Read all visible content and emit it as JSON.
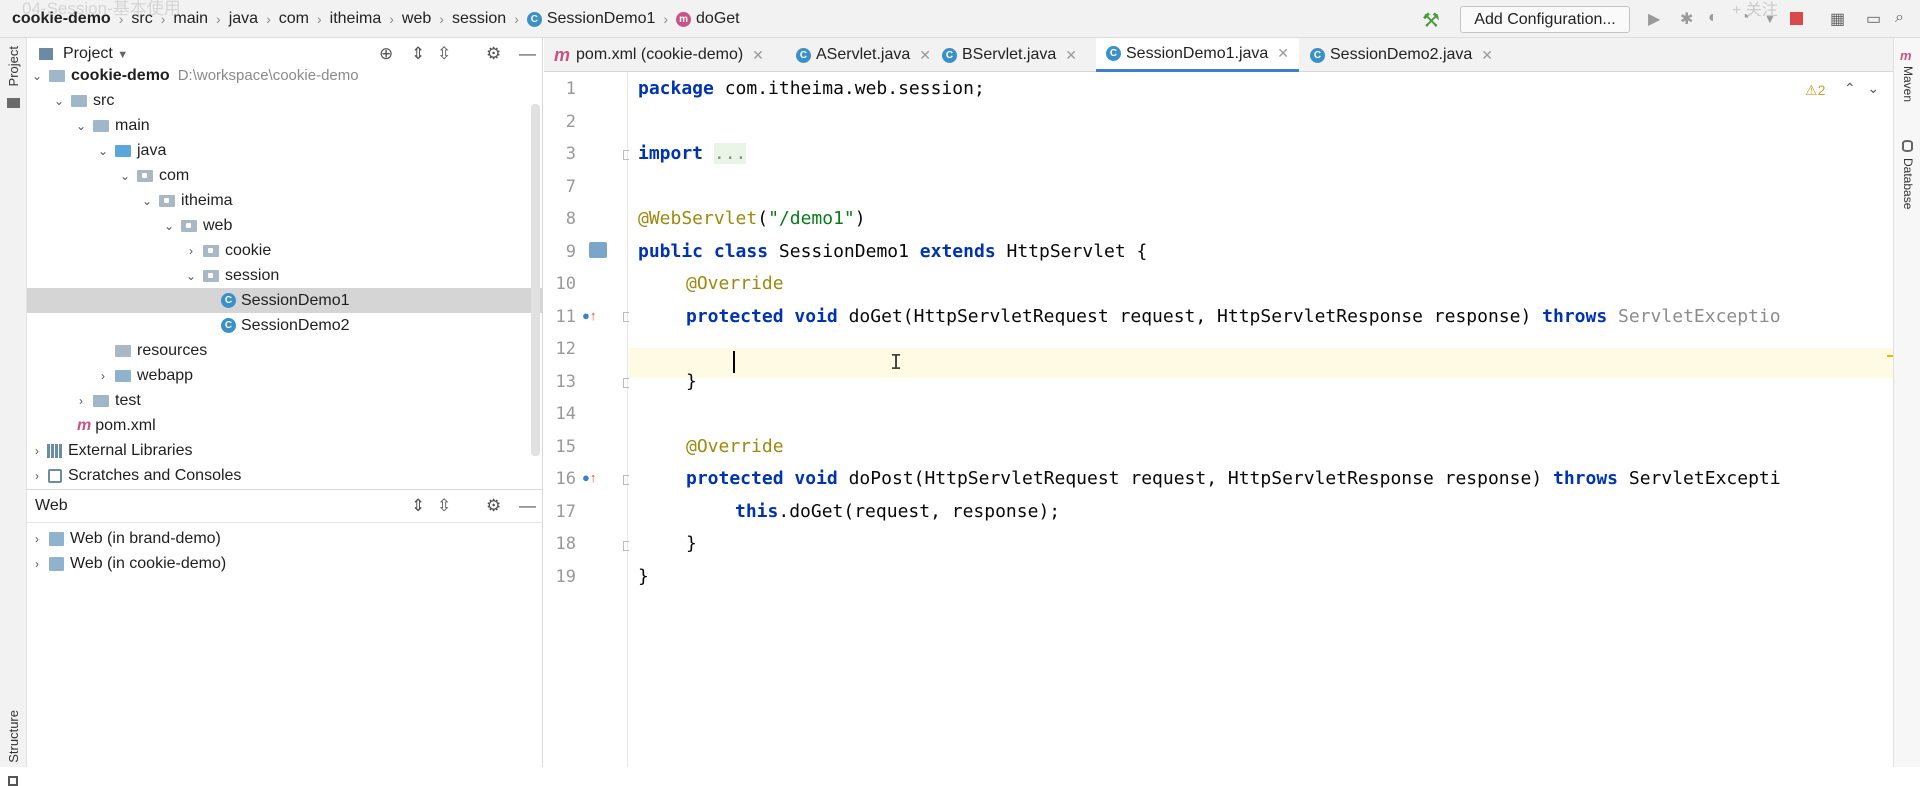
{
  "window": {
    "watermark": "04-Session-基本使用",
    "overlay": "+ 关注"
  },
  "breadcrumb": [
    "cookie-demo",
    "src",
    "main",
    "java",
    "com",
    "itheima",
    "web",
    "session",
    "SessionDemo1",
    "doGet"
  ],
  "toolbar": {
    "run_config": "Add Configuration..."
  },
  "side_left": {
    "project_tab": "Project",
    "structure_tab": "Structure"
  },
  "side_right": {
    "maven_tab": "Maven",
    "database_tab": "Database"
  },
  "project_panel": {
    "title": "Project",
    "tree": [
      {
        "label": "cookie-demo",
        "path": "D:\\workspace\\cookie-demo"
      },
      {
        "label": "src"
      },
      {
        "label": "main"
      },
      {
        "label": "java"
      },
      {
        "label": "com"
      },
      {
        "label": "itheima"
      },
      {
        "label": "web"
      },
      {
        "label": "cookie"
      },
      {
        "label": "session"
      },
      {
        "label": "SessionDemo1"
      },
      {
        "label": "SessionDemo2"
      },
      {
        "label": "resources"
      },
      {
        "label": "webapp"
      },
      {
        "label": "test"
      },
      {
        "label": "pom.xml"
      },
      {
        "label": "External Libraries"
      },
      {
        "label": "Scratches and Consoles"
      }
    ]
  },
  "web_panel": {
    "title": "Web",
    "items": [
      "Web (in brand-demo)",
      "Web (in cookie-demo)"
    ]
  },
  "editor_tabs": [
    "pom.xml (cookie-demo)",
    "AServlet.java",
    "BServlet.java",
    "SessionDemo1.java",
    "SessionDemo2.java"
  ],
  "active_tab": "SessionDemo1.java",
  "editor": {
    "warnings_count": "2",
    "line_numbers": [
      "1",
      "2",
      "3",
      "7",
      "8",
      "9",
      "10",
      "11",
      "12",
      "13",
      "14",
      "15",
      "16",
      "17",
      "18",
      "19"
    ],
    "code": {
      "l1_kw": "package",
      "l1_rest": " com.itheima.web.session;",
      "l3_kw": "import",
      "l3_rest": "...",
      "l8_ann": "@WebServlet",
      "l8_open": "(",
      "l8_str": "\"/demo1\"",
      "l8_close": ")",
      "l9_kw1": "public",
      "l9_kw2": "class",
      "l9_name": "SessionDemo1",
      "l9_kw3": "extends",
      "l9_rest": "HttpServlet {",
      "l10_ann": "@Override",
      "l11_kw1": "protected",
      "l11_kw2": "void",
      "l11_sig": "doGet(HttpServletRequest request, HttpServletResponse response)",
      "l11_kw3": "throws",
      "l11_exc": "ServletExceptio",
      "l13_brace": "}",
      "l15_ann": "@Override",
      "l16_kw1": "protected",
      "l16_kw2": "void",
      "l16_sig": "doPost(HttpServletRequest request, HttpServletResponse response)",
      "l16_kw3": "throws",
      "l16_exc": "ServletExcepti",
      "l17_kw": "this",
      "l17_rest": ".doGet(request, response);",
      "l18_brace": "}",
      "l19_brace": "}"
    }
  }
}
